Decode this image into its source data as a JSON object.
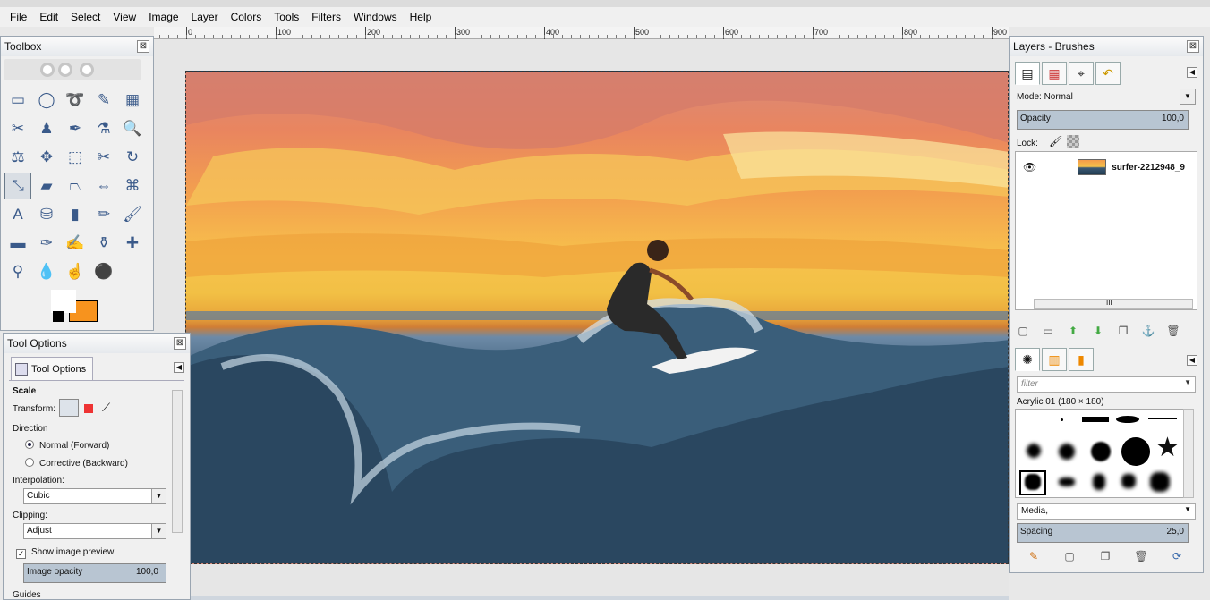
{
  "menubar": {
    "items": [
      "File",
      "Edit",
      "Select",
      "View",
      "Image",
      "Layer",
      "Colors",
      "Tools",
      "Filters",
      "Windows",
      "Help"
    ]
  },
  "ruler": {
    "labels": [
      "100",
      "0",
      "100",
      "200",
      "300",
      "400",
      "500",
      "600",
      "700",
      "800",
      "900"
    ]
  },
  "toolbox": {
    "title": "Toolbox",
    "close": "⊠",
    "tools": [
      {
        "name": "rect-select-icon",
        "glyph": "▭"
      },
      {
        "name": "ellipse-select-icon",
        "glyph": "◯"
      },
      {
        "name": "free-select-icon",
        "glyph": "➰"
      },
      {
        "name": "fuzzy-select-icon",
        "glyph": "✎"
      },
      {
        "name": "color-select-icon",
        "glyph": "▦"
      },
      {
        "name": "scissors-icon",
        "glyph": "✂"
      },
      {
        "name": "foreground-select-icon",
        "glyph": "♟"
      },
      {
        "name": "paths-icon",
        "glyph": "✒"
      },
      {
        "name": "color-picker-icon",
        "glyph": "⚗"
      },
      {
        "name": "zoom-icon",
        "glyph": "🔍"
      },
      {
        "name": "measure-icon",
        "glyph": "⚖"
      },
      {
        "name": "move-icon",
        "glyph": "✥"
      },
      {
        "name": "align-icon",
        "glyph": "⬚"
      },
      {
        "name": "crop-icon",
        "glyph": "✂"
      },
      {
        "name": "rotate-icon",
        "glyph": "↻"
      },
      {
        "name": "scale-icon",
        "glyph": "⤡"
      },
      {
        "name": "shear-icon",
        "glyph": "▰"
      },
      {
        "name": "perspective-icon",
        "glyph": "⏢"
      },
      {
        "name": "flip-icon",
        "glyph": "⇔"
      },
      {
        "name": "cage-icon",
        "glyph": "⌘"
      },
      {
        "name": "text-icon",
        "glyph": "A"
      },
      {
        "name": "bucket-fill-icon",
        "glyph": "⛁"
      },
      {
        "name": "blend-icon",
        "glyph": "▮"
      },
      {
        "name": "pencil-icon",
        "glyph": "✏"
      },
      {
        "name": "paintbrush-icon",
        "glyph": "🖌"
      },
      {
        "name": "eraser-icon",
        "glyph": "▬"
      },
      {
        "name": "airbrush-icon",
        "glyph": "✑"
      },
      {
        "name": "ink-icon",
        "glyph": "✍"
      },
      {
        "name": "clone-icon",
        "glyph": "⚱"
      },
      {
        "name": "heal-icon",
        "glyph": "✚"
      },
      {
        "name": "perspective-clone-icon",
        "glyph": "⚲"
      },
      {
        "name": "blur-icon",
        "glyph": "💧"
      },
      {
        "name": "smudge-icon",
        "glyph": "☝"
      },
      {
        "name": "dodge-burn-icon",
        "glyph": "⚫"
      }
    ],
    "active_index": 15,
    "fg_color": "#000000",
    "bg_color": "#f7931e"
  },
  "tool_options": {
    "title": "Tool Options",
    "close": "⊠",
    "tab_label": "Tool Options",
    "heading": "Scale",
    "transform_label": "Transform:",
    "direction_label": "Direction",
    "direction_options": [
      "Normal (Forward)",
      "Corrective (Backward)"
    ],
    "direction_selected": 0,
    "interpolation_label": "Interpolation:",
    "interpolation_value": "Cubic",
    "clipping_label": "Clipping:",
    "clipping_value": "Adjust",
    "preview_label": "Show image preview",
    "preview_checked": true,
    "opacity_label": "Image opacity",
    "opacity_value": "100,0",
    "guides_label": "Guides"
  },
  "layers": {
    "title": "Layers - Brushes",
    "close": "⊠",
    "mode_label": "Mode: Normal",
    "opacity_label": "Opacity",
    "opacity_value": "100,0",
    "lock_label": "Lock:",
    "layer_name": "surfer-2212948_9",
    "scroll_grip": "III",
    "brush_filter_placeholder": "filter",
    "brush_name": "Acrylic 01 (180 × 180)",
    "brush_tag": "Media,",
    "spacing_label": "Spacing",
    "spacing_value": "25,0"
  },
  "colors": {
    "selection_blue": "#b8c5d2",
    "accent_orange": "#f7931e"
  }
}
